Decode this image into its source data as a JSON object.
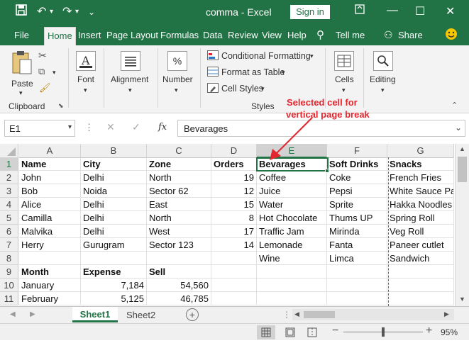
{
  "window": {
    "title": "comma  -  Excel",
    "sign_in": "Sign in",
    "min": "—",
    "restore": "☐",
    "close": "✕"
  },
  "tabs": [
    {
      "label": "File"
    },
    {
      "label": "Home"
    },
    {
      "label": "Insert"
    },
    {
      "label": "Page Layout"
    },
    {
      "label": "Formulas"
    },
    {
      "label": "Data"
    },
    {
      "label": "Review"
    },
    {
      "label": "View"
    },
    {
      "label": "Help"
    },
    {
      "label": "Tell me"
    },
    {
      "label": "Share"
    }
  ],
  "ribbon": {
    "paste": "Paste",
    "clipboard": "Clipboard",
    "font": "Font",
    "alignment": "Alignment",
    "number": "Number",
    "conditional_formatting": "Conditional Formatting",
    "format_as_table": "Format as Table",
    "cell_styles": "Cell Styles",
    "styles": "Styles",
    "cells": "Cells",
    "editing": "Editing"
  },
  "annotation": {
    "line1": "Selected cell for",
    "line2": "vertical page break"
  },
  "formula_bar": {
    "name_box": "E1",
    "fx": "fx",
    "value": "Bevarages"
  },
  "columns": [
    "A",
    "B",
    "C",
    "D",
    "E",
    "F",
    "G"
  ],
  "rows": [
    "1",
    "2",
    "3",
    "4",
    "5",
    "6",
    "7",
    "8",
    "9",
    "10",
    "11"
  ],
  "grid": [
    [
      "Name",
      "City",
      "Zone",
      "Orders",
      "Bevarages",
      "Soft Drinks",
      "Snacks"
    ],
    [
      "John",
      "Delhi",
      "North",
      "19",
      "Coffee",
      "Coke",
      "French Fries"
    ],
    [
      "Bob",
      "Noida",
      "Sector 62",
      "12",
      "Juice",
      "Pepsi",
      "White Sauce Pa"
    ],
    [
      "Alice",
      "Delhi",
      "East",
      "15",
      "Water",
      "Sprite",
      "Hakka Noodles"
    ],
    [
      "Camilla",
      "Delhi",
      "North",
      "8",
      "Hot Chocolate",
      "Thums UP",
      "Spring Roll"
    ],
    [
      "Malvika",
      "Delhi",
      "West",
      "17",
      "Traffic Jam",
      "Mirinda",
      "Veg Roll"
    ],
    [
      "Herry",
      "Gurugram",
      "Sector 123",
      "14",
      "Lemonade",
      "Fanta",
      "Paneer cutlet"
    ],
    [
      "",
      "",
      "",
      "",
      "Wine",
      "Limca",
      "Sandwich"
    ],
    [
      "Month",
      "Expense",
      "Sell",
      "",
      "",
      "",
      ""
    ],
    [
      "January",
      "7,184",
      "54,560",
      "",
      "",
      "",
      ""
    ],
    [
      "February",
      "5,125",
      "46,785",
      "",
      "",
      "",
      ""
    ]
  ],
  "sheets": [
    {
      "label": "Sheet1"
    },
    {
      "label": "Sheet2"
    }
  ],
  "status": {
    "zoom": "95%"
  },
  "colors": {
    "accent": "#217346",
    "annotation": "#e3262f"
  }
}
